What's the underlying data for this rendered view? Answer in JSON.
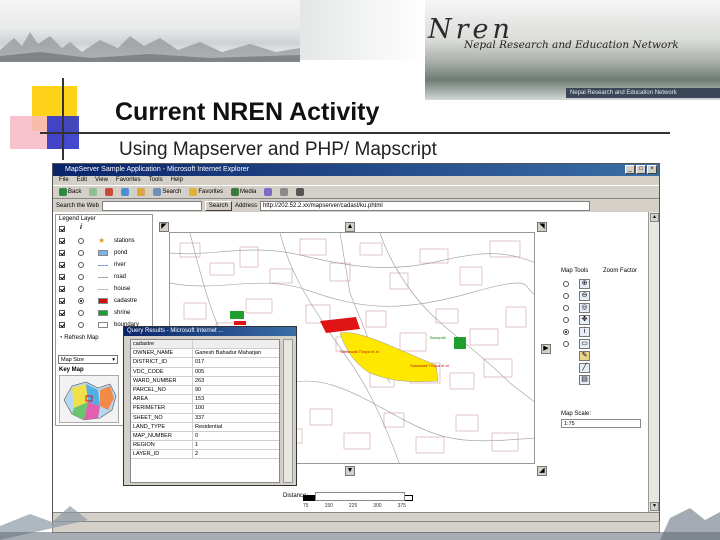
{
  "slide": {
    "title": "Current NREN Activity",
    "subtitle": "Using Mapserver and PHP/ Mapscript"
  },
  "brand": {
    "logo": "Nren",
    "tagline": "Nepal Research and Education Network",
    "bar": "Nepal Research and Education Network"
  },
  "browser": {
    "title": "MapServer Sample Application - Microsoft Internet Explorer",
    "menu": [
      "File",
      "Edit",
      "View",
      "Favorites",
      "Tools",
      "Help"
    ],
    "toolbar": {
      "back": "Back",
      "search": "Search",
      "favorites": "Favorites",
      "media": "Media"
    },
    "search_label": "Search the Web",
    "search_button": "Search",
    "address_label": "Address",
    "address_value": "http://202.52.2.xx/mapserver/cadast/ku.phtml"
  },
  "legend": {
    "title": "Legend   Layer",
    "layers": [
      {
        "name": "stations",
        "checked": true,
        "active": false,
        "color": "#e0a030",
        "shape": "star"
      },
      {
        "name": "pond",
        "checked": true,
        "active": false,
        "color": "#7fb3e6",
        "shape": "box"
      },
      {
        "name": "river",
        "checked": true,
        "active": false,
        "color": "#6a9ed8",
        "shape": "line"
      },
      {
        "name": "road",
        "checked": true,
        "active": false,
        "color": "#9a9a9a",
        "shape": "line"
      },
      {
        "name": "house",
        "checked": true,
        "active": false,
        "color": "#b0b0b0",
        "shape": "line"
      },
      {
        "name": "cadastre",
        "checked": true,
        "active": true,
        "color": "#cc1111",
        "shape": "box"
      },
      {
        "name": "shrine",
        "checked": true,
        "active": false,
        "color": "#1e9e2e",
        "shape": "box"
      },
      {
        "name": "boundary",
        "checked": true,
        "active": false,
        "color": "#ffffff",
        "shape": "box"
      }
    ],
    "refresh": "Refresh Map",
    "map_size": "Map Size",
    "key_map": "Key Map"
  },
  "map": {
    "label_1": "Banepali",
    "label_2": "Saraswati Thapa et al",
    "label_3": "Saraswati Thapa et al",
    "scale_ticks": [
      "75",
      "150",
      "225",
      "300",
      "375"
    ],
    "distance_label": "Distance:"
  },
  "tools": {
    "title": "Map Tools",
    "zoom_factor": "Zoom Factor",
    "items": [
      "zoom-in",
      "zoom-out",
      "zoom-full",
      "pan",
      "info",
      "measure"
    ],
    "selected": 4,
    "scale_label": "Map Scale:",
    "scale_value": "1:75"
  },
  "popup": {
    "title": "Query Results - Microsoft Internet ...",
    "header": "cadastre",
    "rows": [
      [
        "OWNER_NAME",
        "Ganesh Bahadur Maharjan"
      ],
      [
        "DISTRICT_ID",
        "017"
      ],
      [
        "VDC_CODE",
        "005"
      ],
      [
        "WARD_NUMBER",
        "263"
      ],
      [
        "PARCEL_NO",
        "90"
      ],
      [
        "AREA",
        "153"
      ],
      [
        "PERIMETER",
        "100"
      ],
      [
        "SHEET_NO",
        "337"
      ],
      [
        "LAND_TYPE",
        "Residential"
      ],
      [
        "MAP_NUMBER",
        "0"
      ],
      [
        "REGION",
        "1"
      ],
      [
        "LAYER_ID",
        "2"
      ]
    ]
  },
  "colors": {
    "parcel_red": "#e01414",
    "parcel_yellow": "#ffe800",
    "parcel_green": "#1ea02e",
    "road_gray": "#9a9a9a"
  }
}
